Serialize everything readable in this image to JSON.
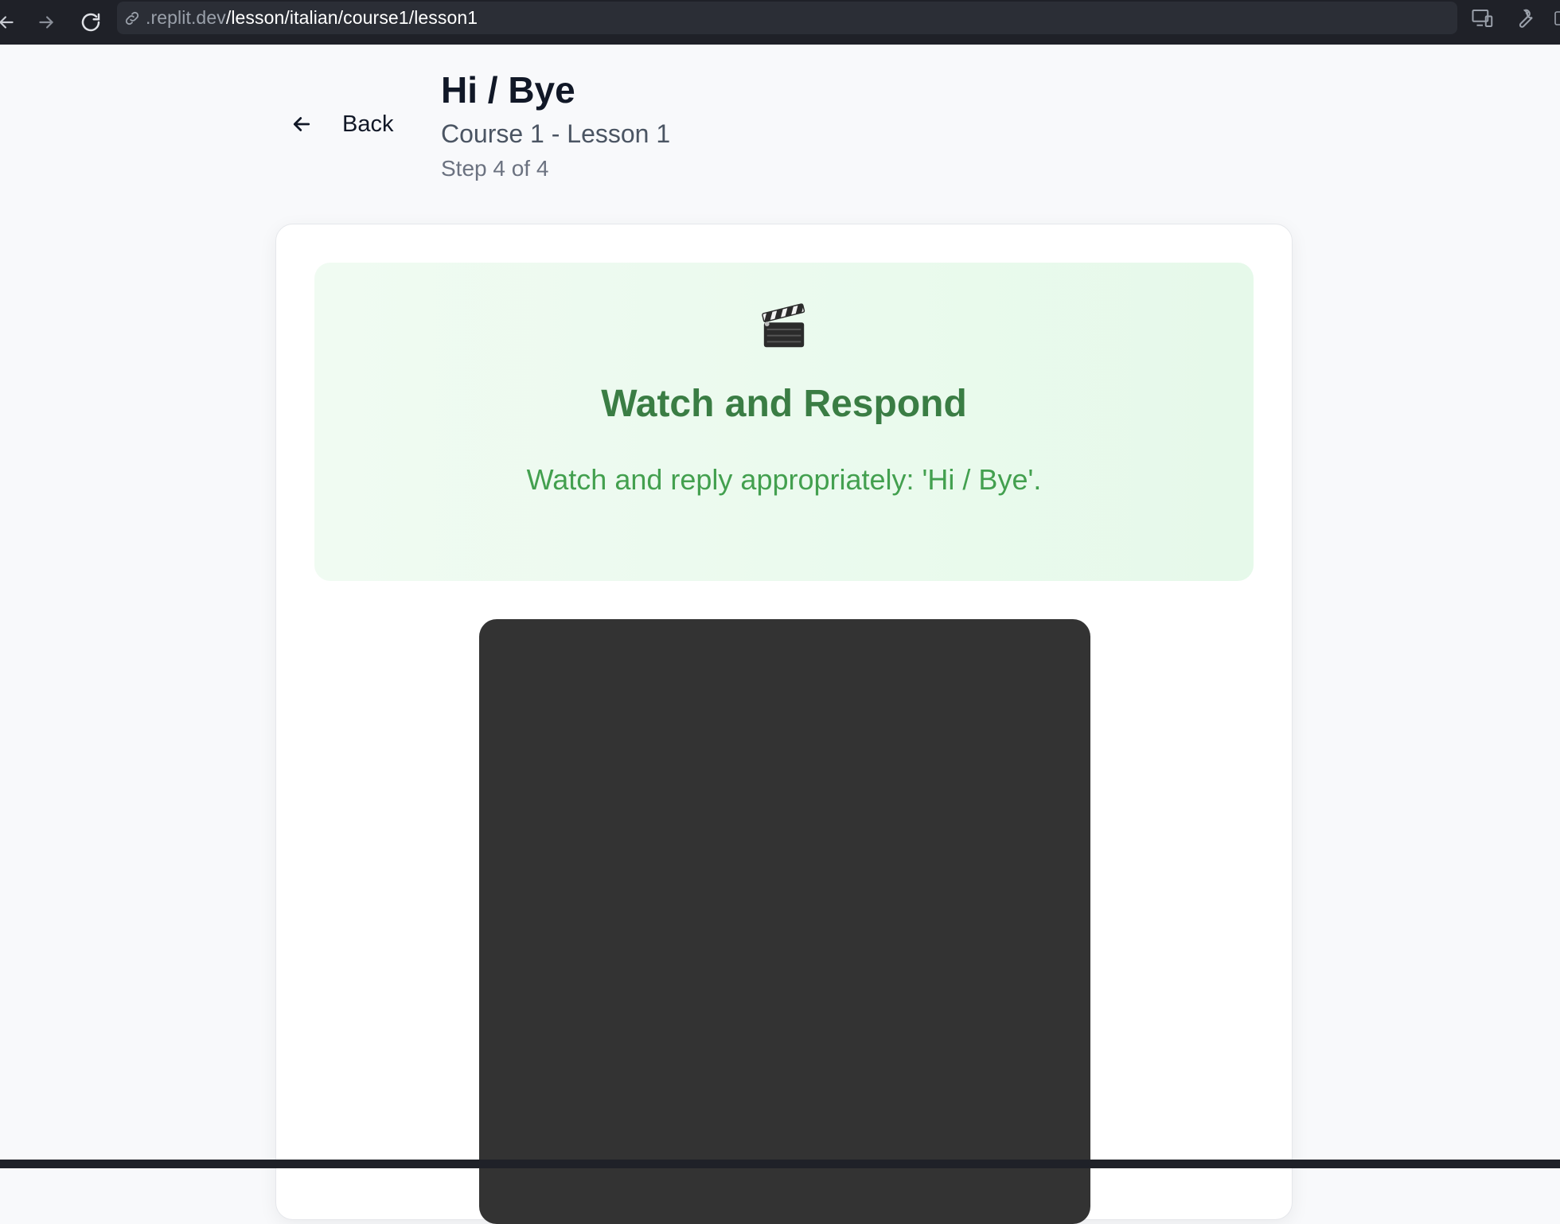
{
  "browser": {
    "url_host": ".replit.dev",
    "url_path": "/lesson/italian/course1/lesson1"
  },
  "header": {
    "back_label": "Back",
    "title": "Hi / Bye",
    "subtitle": "Course 1 - Lesson 1",
    "step": "Step 4 of 4"
  },
  "activity": {
    "icon": "clapper-board-icon",
    "title": "Watch and Respond",
    "instruction": "Watch and reply appropriately: 'Hi / Bye'."
  },
  "colors": {
    "accent_green": "#3a7d44",
    "instruction_green": "#43a04f",
    "banner_bg": "#e6f9ea",
    "video_bg": "#333333"
  }
}
